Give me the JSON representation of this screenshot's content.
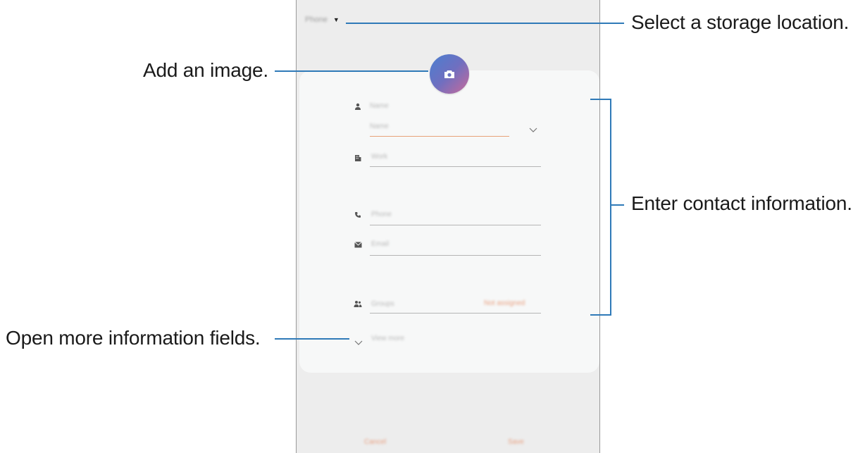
{
  "callouts": {
    "storage": "Select a storage location.",
    "image": "Add an image.",
    "contact_info": "Enter contact information.",
    "more_fields": "Open more information fields."
  },
  "screen": {
    "storage_location": "Phone",
    "fields": {
      "name_label": "Name",
      "name_value": "Name",
      "organisation": "Work",
      "phone": "Phone",
      "email": "Email",
      "groups": "Groups",
      "groups_value": "Not assigned",
      "view_more": "View more"
    },
    "buttons": {
      "cancel": "Cancel",
      "save": "Save"
    }
  },
  "colors": {
    "callout_line": "#2f7ab8",
    "active_underline": "#e8a27a",
    "accent_text": "#e8a080",
    "photo_gradient_start": "#4a7fd0",
    "photo_gradient_end": "#c96a9a"
  },
  "icons": {
    "dropdown": "caret-down-icon",
    "camera": "camera-icon",
    "person": "person-icon",
    "organisation": "building-icon",
    "phone": "phone-icon",
    "email": "envelope-icon",
    "groups": "group-icon",
    "expand": "chevron-down-icon"
  }
}
